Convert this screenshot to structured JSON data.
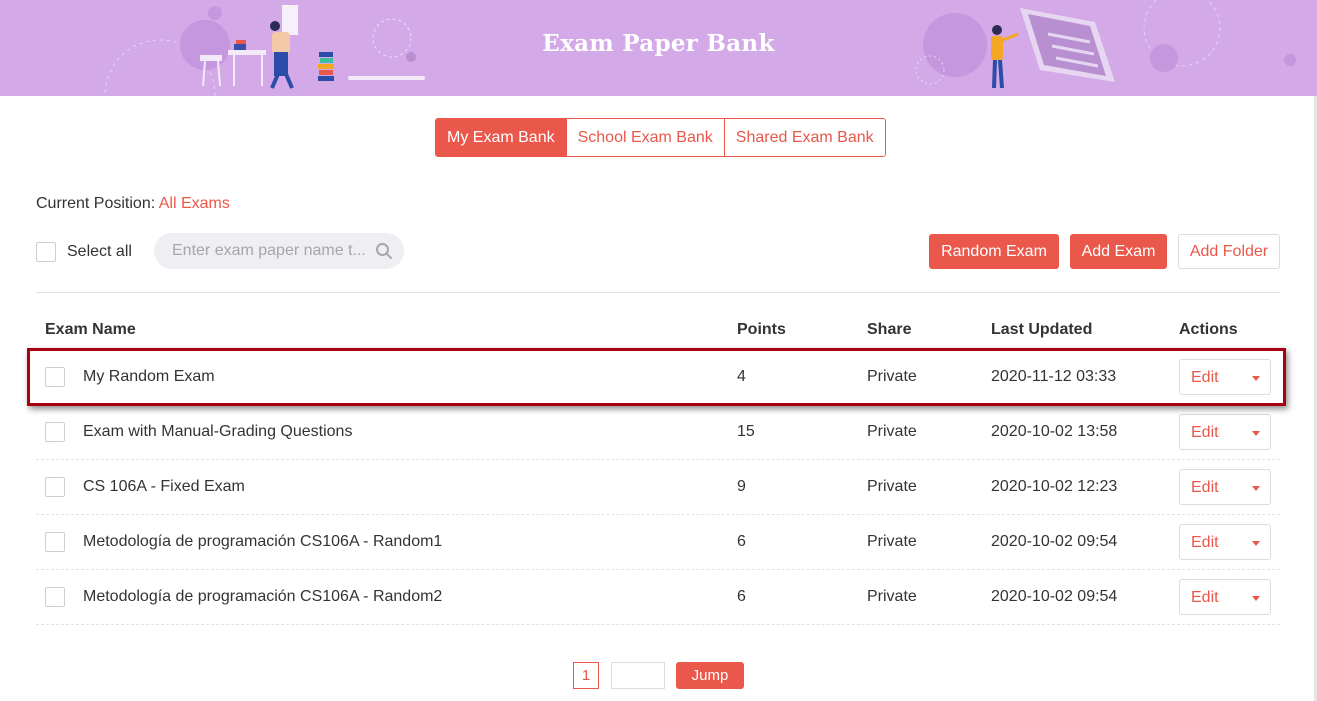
{
  "header": {
    "title": "Exam Paper Bank"
  },
  "tabs": [
    {
      "label": "My Exam Bank",
      "active": true
    },
    {
      "label": "School Exam Bank",
      "active": false
    },
    {
      "label": "Shared Exam Bank",
      "active": false
    }
  ],
  "breadcrumb": {
    "prefix": "Current Position:",
    "current": "All Exams"
  },
  "toolbar": {
    "select_all_label": "Select all",
    "search_placeholder": "Enter exam paper name t...",
    "random_exam_label": "Random Exam",
    "add_exam_label": "Add Exam",
    "add_folder_label": "Add Folder"
  },
  "table": {
    "columns": [
      "Exam Name",
      "Points",
      "Share",
      "Last Updated",
      "Actions"
    ],
    "rows": [
      {
        "name": "My Random Exam",
        "points": "4",
        "share": "Private",
        "updated": "2020-11-12 03:33",
        "action": "Edit"
      },
      {
        "name": "Exam with Manual-Grading Questions",
        "points": "15",
        "share": "Private",
        "updated": "2020-10-02 13:58",
        "action": "Edit"
      },
      {
        "name": "CS 106A - Fixed Exam",
        "points": "9",
        "share": "Private",
        "updated": "2020-10-02 12:23",
        "action": "Edit"
      },
      {
        "name": "Metodología de programación CS106A - Random1",
        "points": "6",
        "share": "Private",
        "updated": "2020-10-02 09:54",
        "action": "Edit"
      },
      {
        "name": "Metodología de programación CS106A - Random2",
        "points": "6",
        "share": "Private",
        "updated": "2020-10-02 09:54",
        "action": "Edit"
      }
    ]
  },
  "pagination": {
    "current_page": "1",
    "jump_label": "Jump"
  },
  "colors": {
    "accent": "#e9584b",
    "banner": "#d3a9e8",
    "highlight": "#a8000c"
  }
}
